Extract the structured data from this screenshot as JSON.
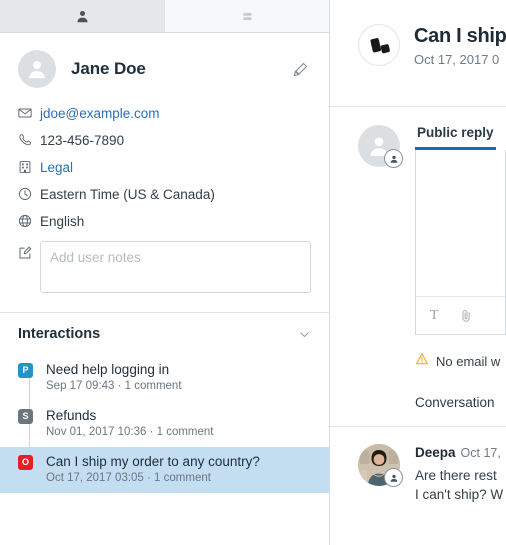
{
  "left_panel": {
    "tabs": [
      {
        "icon": "person-icon",
        "active": true
      },
      {
        "icon": "cards-list-icon",
        "active": false
      }
    ],
    "profile": {
      "name": "Jane Doe",
      "avatar_icon": "person-avatar-icon",
      "edit_icon": "pencil-icon"
    },
    "fields": [
      {
        "icon": "envelope-icon",
        "value": "jdoe@example.com",
        "is_link": true
      },
      {
        "icon": "phone-icon",
        "value": "123-456-7890",
        "is_link": false
      },
      {
        "icon": "building-icon",
        "value": "Legal",
        "is_link": true
      },
      {
        "icon": "clock-icon",
        "value": "Eastern Time (US & Canada)",
        "is_link": false
      },
      {
        "icon": "globe-icon",
        "value": "English",
        "is_link": false
      }
    ],
    "notes": {
      "icon": "note-edit-icon",
      "placeholder": "Add user notes",
      "value": ""
    },
    "interactions": {
      "title": "Interactions",
      "collapse_icon": "chevron-down-icon",
      "items": [
        {
          "badge": "P",
          "badge_color": "#2196c4",
          "subject": "Need help logging in",
          "meta": "Sep 17 09:43 · 1 comment",
          "selected": false
        },
        {
          "badge": "S",
          "badge_color": "#6b7680",
          "subject": "Refunds",
          "meta": "Nov 01, 2017 10:36 · 1 comment",
          "selected": false
        },
        {
          "badge": "O",
          "badge_color": "#e32124",
          "subject": "Can I ship my order to any country?",
          "meta": "Oct 17, 2017 03:05 · 1 comment",
          "selected": true
        }
      ]
    }
  },
  "right_panel": {
    "conversation": {
      "logo_icon": "brand-logo-icon",
      "title": "Can I ship",
      "subtitle": "Oct 17, 2017 0"
    },
    "composer": {
      "avatar_icon": "person-avatar-icon",
      "avatar_badge_icon": "person-badge-icon",
      "tabs": [
        {
          "label": "Public reply",
          "active": true
        }
      ],
      "editor_value": "",
      "toolbar": [
        {
          "icon": "text-format-icon",
          "glyph": "T"
        },
        {
          "icon": "paperclip-icon"
        }
      ],
      "warning": {
        "icon": "warning-triangle-icon",
        "text": "No email w"
      },
      "conversation_label": "Conversation"
    },
    "message": {
      "avatar_icon": "user-photo-avatar",
      "avatar_badge_icon": "person-badge-icon",
      "author": "Deepa",
      "date": "Oct 17,",
      "lines": [
        "Are there rest",
        "I can't ship? W"
      ]
    }
  },
  "colors": {
    "accent_blue": "#1a6bb5",
    "link_blue": "#2f6fb0",
    "selected_row": "#c3ddf1",
    "warning_orange": "#f0a41e",
    "badge_red": "#e32124",
    "badge_blue": "#2196c4",
    "badge_grey": "#6b7680"
  }
}
